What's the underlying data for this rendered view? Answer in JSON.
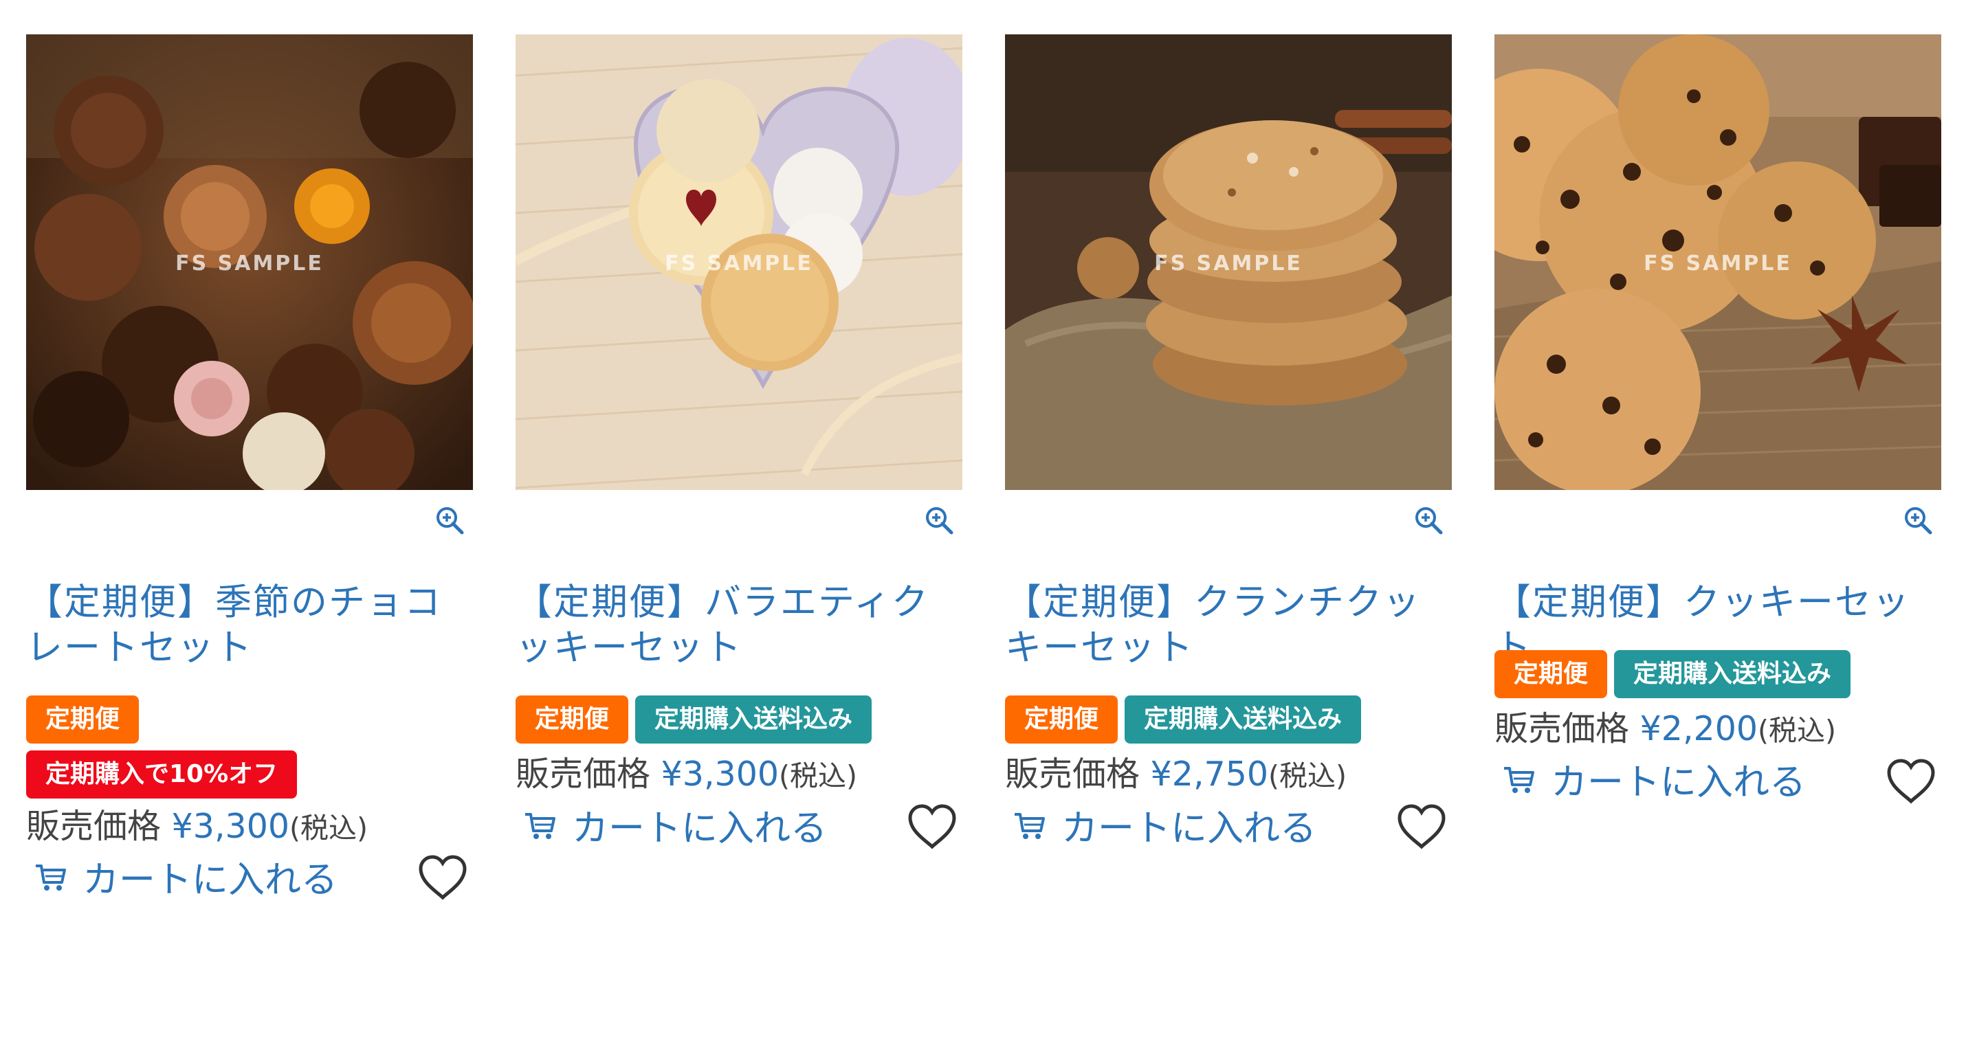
{
  "products": [
    {
      "title": "【定期便】季節のチョコレートセット",
      "watermark": "FS SAMPLE",
      "tags": [
        {
          "label": "定期便",
          "color": "#ff6a00"
        },
        {
          "label": "定期購入で10%オフ",
          "color": "#ee0a1a"
        }
      ],
      "price_label": "販売価格",
      "price": "¥3,300",
      "tax_label": "(税込)",
      "cart_label": "カートに入れる",
      "image": "chocolate-assortment"
    },
    {
      "title": "【定期便】バラエティクッキーセット",
      "watermark": "FS SAMPLE",
      "tags": [
        {
          "label": "定期便",
          "color": "#ff6a00"
        },
        {
          "label": "定期購入送料込み",
          "color": "#24979b"
        }
      ],
      "price_label": "販売価格",
      "price": "¥3,300",
      "tax_label": "(税込)",
      "cart_label": "カートに入れる",
      "image": "heart-tin-cookies"
    },
    {
      "title": "【定期便】クランチクッキーセット",
      "watermark": "FS SAMPLE",
      "tags": [
        {
          "label": "定期便",
          "color": "#ff6a00"
        },
        {
          "label": "定期購入送料込み",
          "color": "#24979b"
        }
      ],
      "price_label": "販売価格",
      "price": "¥2,750",
      "tax_label": "(税込)",
      "cart_label": "カートに入れる",
      "image": "oat-cookie-stack"
    },
    {
      "title": "【定期便】クッキーセット",
      "watermark": "FS SAMPLE",
      "tags": [
        {
          "label": "定期便",
          "color": "#ff6a00"
        },
        {
          "label": "定期購入送料込み",
          "color": "#24979b"
        }
      ],
      "price_label": "販売価格",
      "price": "¥2,200",
      "tax_label": "(税込)",
      "cart_label": "カートに入れる",
      "image": "chocolate-chip-cookies"
    }
  ],
  "icons": {
    "zoom": "zoom-in-icon",
    "cart": "cart-icon",
    "favorite": "heart-outline-icon"
  },
  "colors": {
    "link": "#2c74b8",
    "tag_orange": "#ff6a00",
    "tag_red": "#ee0a1a",
    "tag_teal": "#24979b"
  }
}
